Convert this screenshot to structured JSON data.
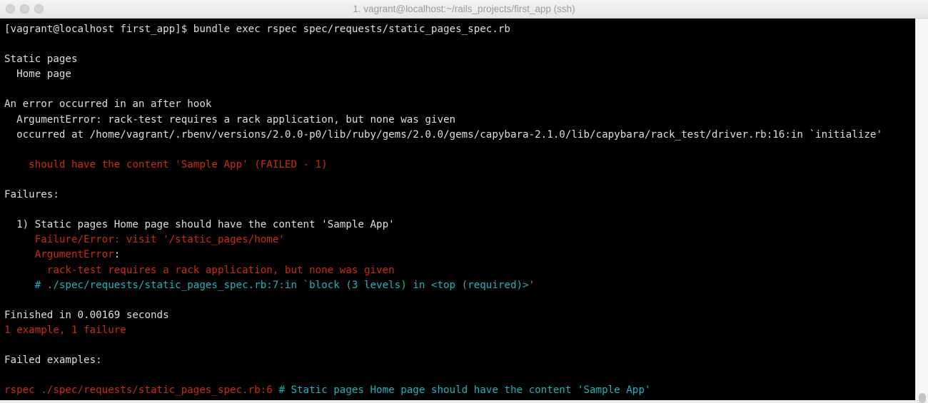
{
  "window": {
    "title": "1. vagrant@localhost:~/rails_projects/first_app (ssh)"
  },
  "colors": {
    "red": "#cc2a12",
    "cyan": "#1db3bb",
    "text": "#dedede",
    "background": "#000000"
  },
  "terminal": {
    "lines": [
      [
        {
          "t": "[vagrant@localhost first_app]$ bundle exec rspec spec/requests/static_pages_spec.rb",
          "c": "white"
        }
      ],
      [],
      [
        {
          "t": "Static pages",
          "c": "white"
        }
      ],
      [
        {
          "t": "  Home page",
          "c": "white"
        }
      ],
      [],
      [
        {
          "t": "An error occurred in an after hook",
          "c": "white"
        }
      ],
      [
        {
          "t": "  ArgumentError: rack-test requires a rack application, but none was given",
          "c": "white"
        }
      ],
      [
        {
          "t": "  occurred at /home/vagrant/.rbenv/versions/2.0.0-p0/lib/ruby/gems/2.0.0/gems/capybara-2.1.0/lib/capybara/rack_test/driver.rb:16:in `initialize'",
          "c": "white"
        }
      ],
      [],
      [
        {
          "t": "    should have the content 'Sample App' (FAILED - 1)",
          "c": "red"
        }
      ],
      [],
      [
        {
          "t": "Failures:",
          "c": "white"
        }
      ],
      [],
      [
        {
          "t": "  1) Static pages Home page should have the content 'Sample App'",
          "c": "white"
        }
      ],
      [
        {
          "t": "     Failure/Error: visit '/static_pages/home'",
          "c": "red"
        }
      ],
      [
        {
          "t": "     ArgumentError",
          "c": "red"
        },
        {
          "t": ":",
          "c": "white"
        }
      ],
      [
        {
          "t": "       rack-test requires a rack application, but none was given",
          "c": "red"
        }
      ],
      [
        {
          "t": "     # ./spec/requests/static_pages_spec.rb:7:in `block (3 levels) in <top (required)>'",
          "c": "cyan"
        }
      ],
      [],
      [
        {
          "t": "Finished in 0.00169 seconds",
          "c": "white"
        }
      ],
      [
        {
          "t": "1 example, 1 failure",
          "c": "red"
        }
      ],
      [],
      [
        {
          "t": "Failed examples:",
          "c": "white"
        }
      ],
      [],
      [
        {
          "t": "rspec ./spec/requests/static_pages_spec.rb:6",
          "c": "red"
        },
        {
          "t": " # Static pages Home page should have the content 'Sample App'",
          "c": "cyan"
        }
      ]
    ]
  }
}
